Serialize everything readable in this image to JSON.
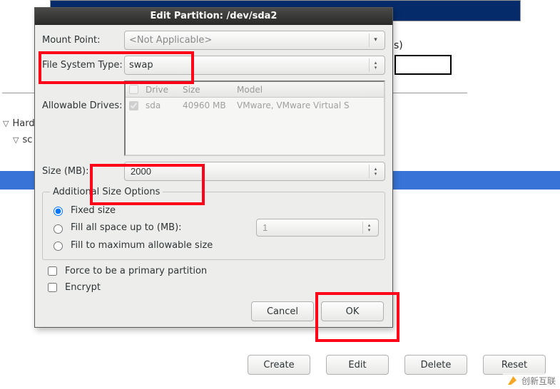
{
  "background": {
    "paren_text": "s)",
    "tree_hard": "Hard",
    "tree_sc": "sc",
    "buttons": {
      "create": "Create",
      "edit": "Edit",
      "delete": "Delete",
      "reset": "Reset"
    }
  },
  "dialog": {
    "title": "Edit Partition: /dev/sda2",
    "mount_point_label": "Mount Point:",
    "mount_point_value": "<Not Applicable>",
    "fstype_label": "File System Type:",
    "fstype_value": "swap",
    "allowable_label": "Allowable Drives:",
    "drives": {
      "header": {
        "drive": "Drive",
        "size": "Size",
        "model": "Model"
      },
      "row": {
        "checked": true,
        "drive": "sda",
        "size": "40960 MB",
        "model": "VMware, VMware Virtual S"
      }
    },
    "size_label": "Size (MB):",
    "size_value": "2000",
    "addl_legend": "Additional Size Options",
    "opt_fixed": "Fixed size",
    "opt_fill_upto": "Fill all space up to (MB):",
    "opt_fill_upto_value": "1",
    "opt_fill_max": "Fill to maximum allowable size",
    "force_primary": "Force to be a primary partition",
    "encrypt": "Encrypt",
    "cancel": "Cancel",
    "ok": "OK"
  },
  "watermark": "创新互联"
}
